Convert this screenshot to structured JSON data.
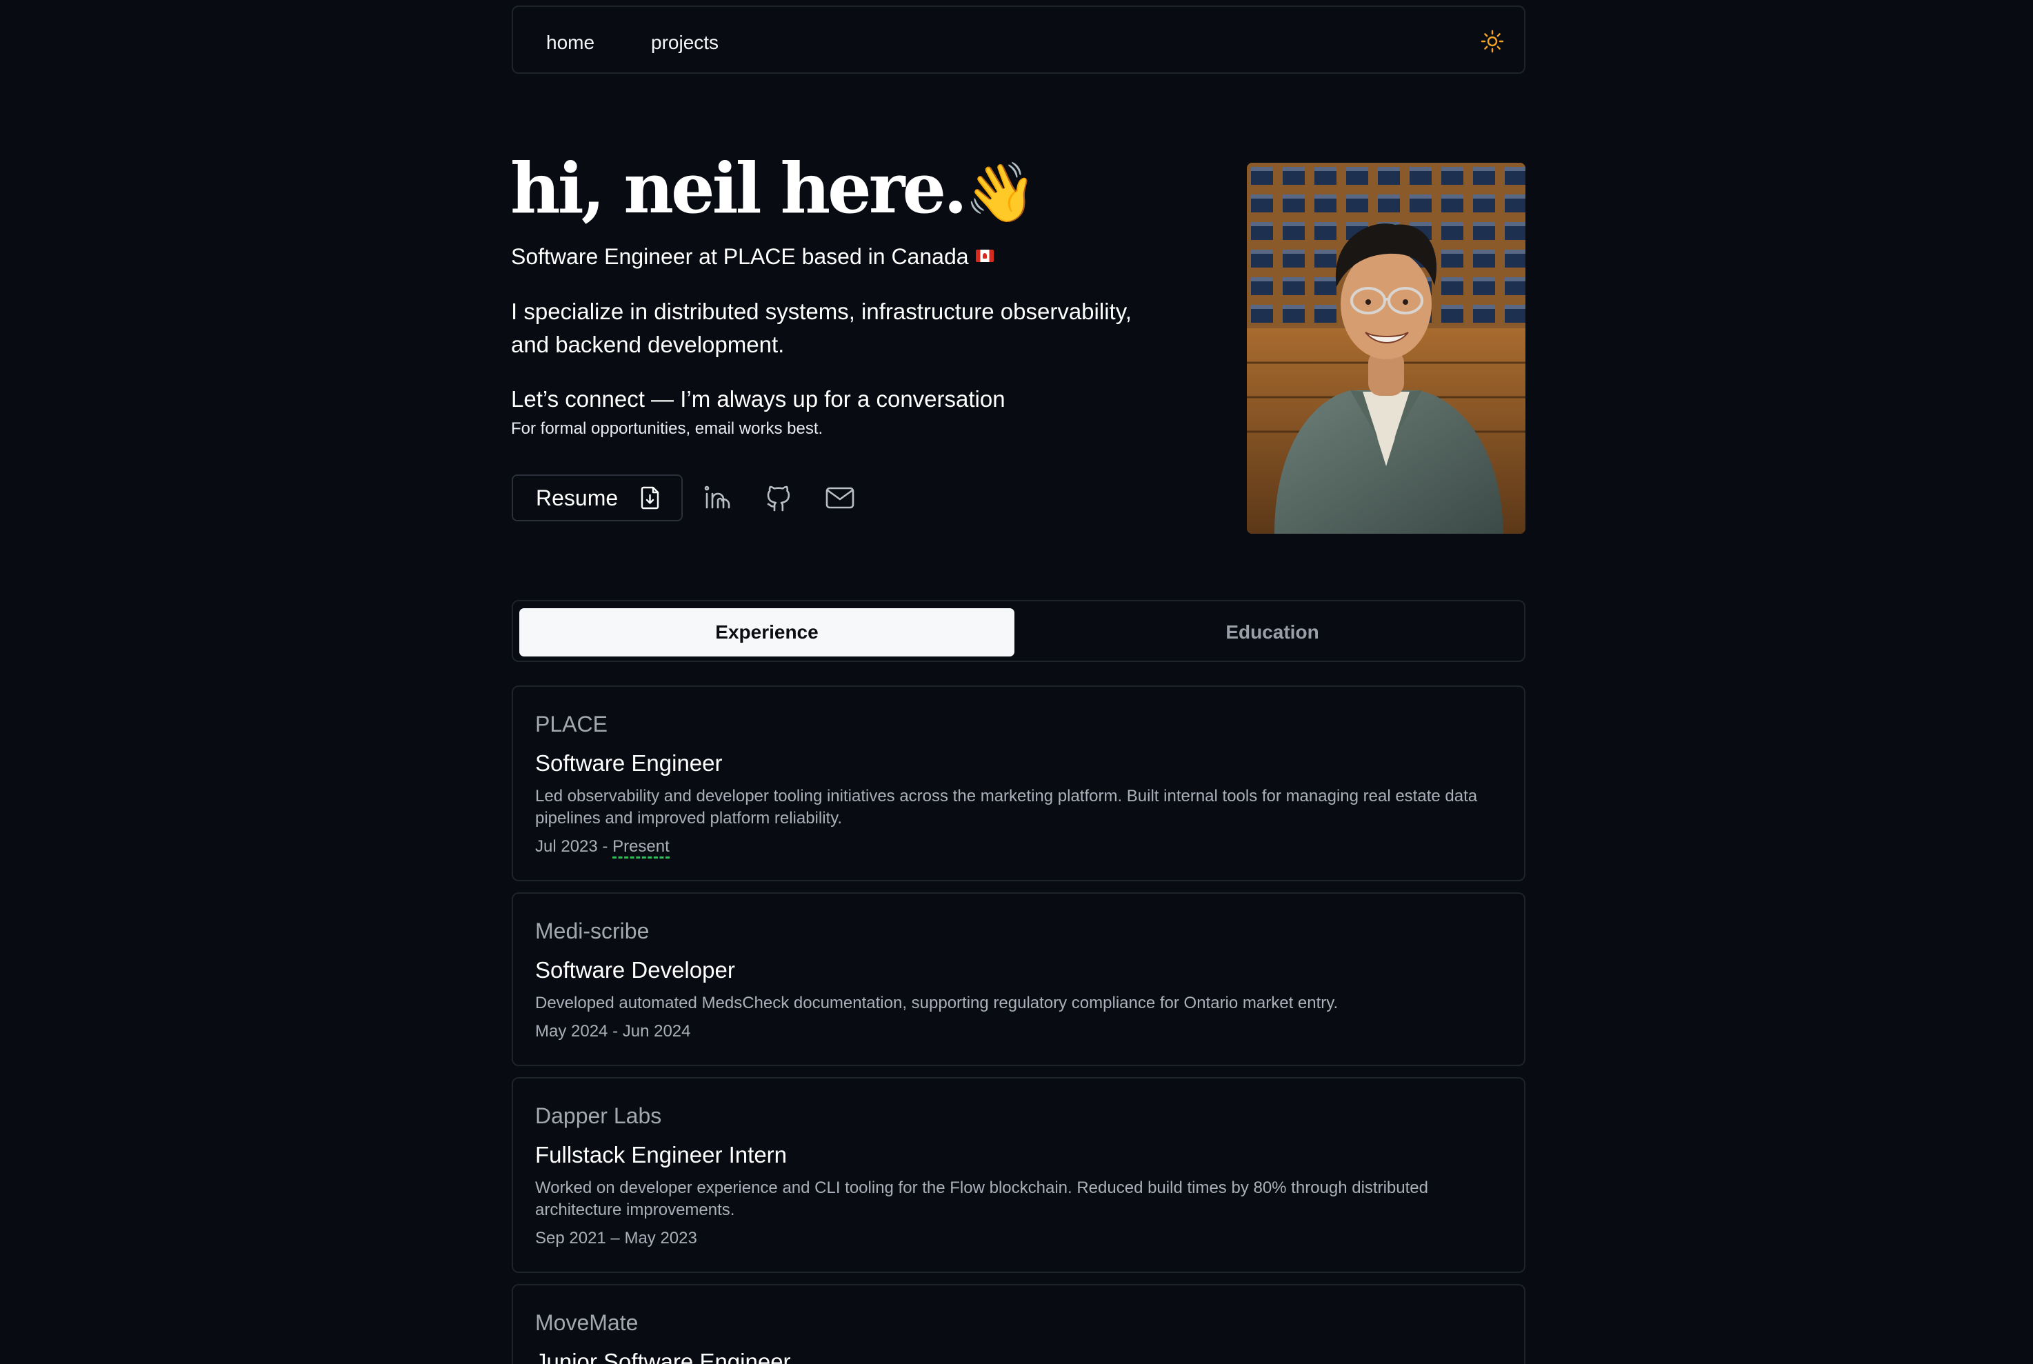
{
  "nav": {
    "home_label": "home",
    "projects_label": "projects",
    "theme_icon": "sun-icon"
  },
  "hero": {
    "title": "hi, neil here.",
    "emoji": "👋",
    "subtitle": "Software Engineer at PLACE based in Canada",
    "flag_icon": "canada-flag-icon",
    "specialize": "I specialize in distributed systems, infrastructure observability, and backend development.",
    "connect": "Let’s connect — I’m always up for a conversation",
    "formal": "For formal opportunities, email works best.",
    "resume_label": "Resume",
    "resume_icon": "file-download-icon",
    "social_icons": [
      "linkedin-icon",
      "github-icon",
      "mail-icon"
    ]
  },
  "tabs": {
    "experience_label": "Experience",
    "education_label": "Education",
    "active": "Experience"
  },
  "experience": [
    {
      "company": "PLACE",
      "role": "Software Engineer",
      "description": "Led observability and developer tooling initiatives across the marketing platform. Built internal tools for managing real estate data pipelines and improved platform reliability.",
      "date_start": "Jul 2023 - ",
      "date_end": "Present"
    },
    {
      "company": "Medi-scribe",
      "role": "Software Developer",
      "description": "Developed automated MedsCheck documentation, supporting regulatory compliance for Ontario market entry.",
      "dates": "May 2024 - Jun 2024"
    },
    {
      "company": "Dapper Labs",
      "role": "Fullstack Engineer Intern",
      "description": "Worked on developer experience and CLI tooling for the Flow blockchain. Reduced build times by 80% through distributed architecture improvements.",
      "dates": "Sep 2021 – May 2023"
    },
    {
      "company": "MoveMate",
      "role": "Junior Software Engineer"
    }
  ],
  "colors": {
    "background": "#080b12",
    "border": "#1f232c",
    "muted_text": "#aab0ba",
    "accent_sun": "#f5a524",
    "present_underline": "#2fbf57"
  }
}
